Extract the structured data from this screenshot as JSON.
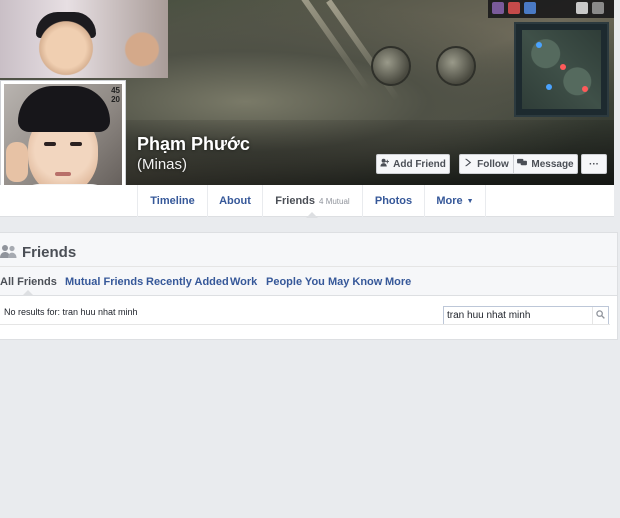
{
  "profile": {
    "name": "Phạm Phước",
    "alternate_name": "(Minas)",
    "avatar_text": "45\n20"
  },
  "actions": {
    "add_friend": "Add Friend",
    "follow": "Follow",
    "message": "Message",
    "more": "···"
  },
  "tabs": {
    "timeline": "Timeline",
    "about": "About",
    "friends": "Friends",
    "friends_mutual": "4 Mutual",
    "photos": "Photos",
    "more": "More",
    "more_caret": "▼"
  },
  "friends_section": {
    "title": "Friends",
    "subtabs": {
      "all": "All Friends",
      "mutual": "Mutual Friends",
      "recent": "Recently Added",
      "work": "Work",
      "pymk": "People You May Know",
      "more": "More"
    },
    "search": {
      "value": "tran huu nhat minh",
      "placeholder": "Search for your friends"
    },
    "no_results": "No results for: tran huu nhat minh"
  },
  "colors": {
    "link": "#365899",
    "panel_bg": "#f6f7f9",
    "page_bg": "#e9ebee"
  },
  "icons": [
    "add-friend-icon",
    "follow-icon",
    "message-icon",
    "friends-icon",
    "search-icon"
  ]
}
